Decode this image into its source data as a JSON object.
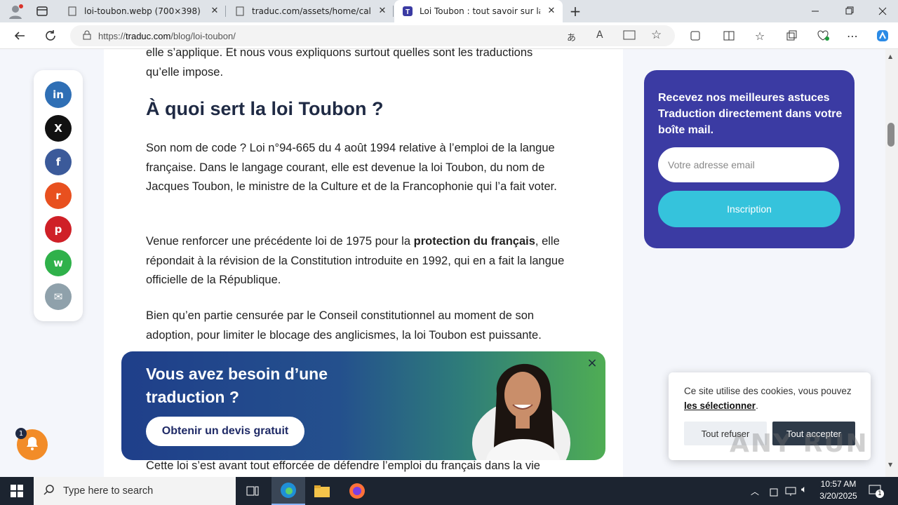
{
  "browser": {
    "tabs": [
      {
        "title": "loi-toubon.webp (700×398)",
        "active": false
      },
      {
        "title": "traduc.com/assets/home/calend",
        "active": false
      },
      {
        "title": "Loi Toubon : tout savoir sur la tra",
        "active": true
      }
    ],
    "url_prefix": "https://",
    "url_domain": "traduc.com",
    "url_path": "/blog/loi-toubon/"
  },
  "article": {
    "intro_line1": "elle s’applique. Et nous vous expliquons surtout quelles sont les traductions",
    "intro_line2": "qu’elle impose.",
    "heading": "À quoi sert la loi Toubon ?",
    "p1": "Son nom de code ? Loi n°94-665 du 4 août 1994 relative à l’emploi de la langue française. Dans le langage courant, elle est devenue la loi Toubon, du nom de Jacques Toubon, le ministre de la Culture et de la Francophonie qui l’a fait voter.",
    "p2_before": "Venue renforcer une précédente loi de 1975 pour la ",
    "p2_bold": "protection du français",
    "p2_after": ", elle répondait à la révision de la Constitution introduite en 1992, qui en a fait la langue officielle de la République.",
    "p3": "Bien qu’en partie censurée par le Conseil constitutionnel au moment de son adoption, pour limiter le blocage des anglicismes, la loi Toubon est puissante.",
    "p4": "Cette loi s’est avant tout efforcée de défendre l’emploi du français dans la vie"
  },
  "social": [
    {
      "name": "linkedin",
      "glyph": "in",
      "color": "#2f6fb5"
    },
    {
      "name": "x",
      "glyph": "X",
      "color": "#111111"
    },
    {
      "name": "facebook",
      "glyph": "f",
      "color": "#3b5a9a"
    },
    {
      "name": "reddit",
      "glyph": "r",
      "color": "#e8501f"
    },
    {
      "name": "pinterest",
      "glyph": "p",
      "color": "#cf2027"
    },
    {
      "name": "whatsapp",
      "glyph": "w",
      "color": "#2fb14a"
    },
    {
      "name": "email",
      "glyph": "✉",
      "color": "#8fa1ab"
    }
  ],
  "newsletter": {
    "title": "Recevez nos meilleures astuces Traduction directement dans votre boîte mail.",
    "placeholder": "Votre adresse email",
    "button": "Inscription"
  },
  "cta": {
    "title": "Vous avez besoin d’une traduction ?",
    "button": "Obtenir un devis gratuit",
    "close": "×"
  },
  "cookie": {
    "text": "Ce site utilise des cookies, vous pouvez ",
    "link": "les sélectionner",
    "text_end": ".",
    "refuse": "Tout refuser",
    "accept": "Tout accepter"
  },
  "notification": {
    "count": "1"
  },
  "watermark": "ANY RUN",
  "taskbar": {
    "search_placeholder": "Type here to search",
    "time": "10:57 AM",
    "date": "3/20/2025",
    "notif_count": "1"
  }
}
